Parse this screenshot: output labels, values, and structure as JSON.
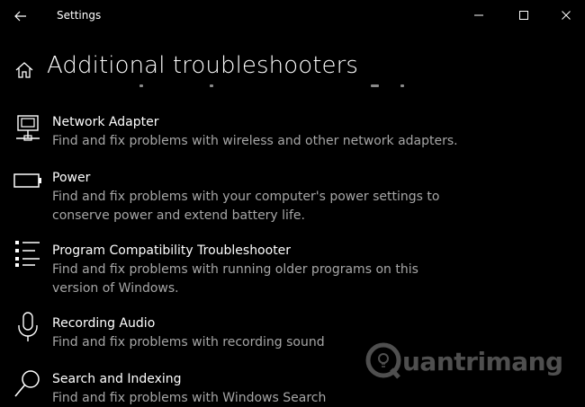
{
  "titlebar": {
    "app_title": "Settings",
    "icons": {
      "back": "back-arrow-icon",
      "minimize": "minimize-icon",
      "maximize": "maximize-icon",
      "close": "close-icon"
    }
  },
  "header": {
    "title": "Additional troubleshooters",
    "icon": "home-icon"
  },
  "items": [
    {
      "title": "Network Adapter",
      "desc_line1": "Find and fix problems with wireless and other network adapters.",
      "desc_line2": "",
      "icon": "network-adapter-icon"
    },
    {
      "title": "Power",
      "desc_line1": "Find and fix problems with your computer's power settings to",
      "desc_line2": "conserve power and extend battery life.",
      "icon": "battery-icon"
    },
    {
      "title": "Program Compatibility Troubleshooter",
      "desc_line1": "Find and fix problems with running older programs on this",
      "desc_line2": "version of Windows.",
      "icon": "list-icon"
    },
    {
      "title": "Recording Audio",
      "desc_line1": "Find and fix problems with recording sound",
      "desc_line2": "",
      "icon": "microphone-icon"
    },
    {
      "title": "Search and Indexing",
      "desc_line1": "Find and fix problems with Windows Search",
      "desc_line2": "",
      "icon": "search-icon"
    }
  ],
  "watermark": {
    "text": "uantrimang",
    "icon": "quantrimang-logo-icon"
  },
  "colors": {
    "background": "#000000",
    "title_text": "#ffffff",
    "desc_text": "#a6a6a6"
  }
}
